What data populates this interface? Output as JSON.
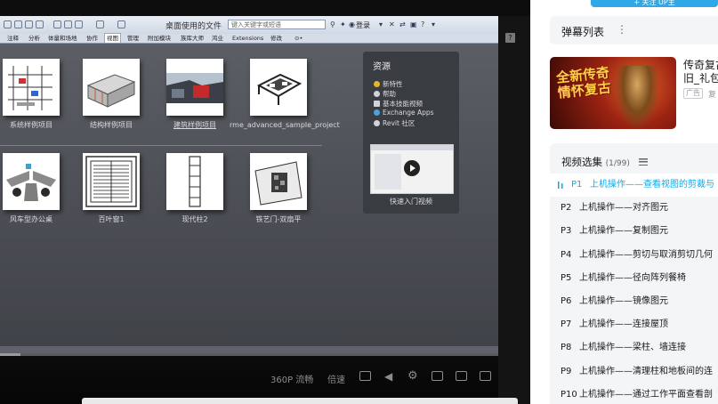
{
  "top_button": {
    "label": "+ 关注 UP主"
  },
  "revit": {
    "doc_title": "桌面使用的文件",
    "search_placeholder": "键入关键字或短语",
    "login_label": "登录",
    "menu": [
      "注释",
      "分析",
      "体量和场地",
      "协作",
      "视图",
      "管理",
      "附加模块",
      "族库大师",
      "鸿业",
      "Extensions",
      "修改",
      "⊙•"
    ],
    "active_menu_index": 4,
    "thumbnails": [
      {
        "label": "系统样例项目",
        "icon": "frame-model-icon"
      },
      {
        "label": "结构样例项目",
        "icon": "structure-model-icon"
      },
      {
        "label": "建筑样例项目",
        "icon": "building-render-icon"
      },
      {
        "label": "rme_advanced_sample_project",
        "icon": "mep-model-icon"
      },
      {
        "label": "风车型办公桌",
        "icon": "desk-icon"
      },
      {
        "label": "百叶窗1",
        "icon": "louver-icon"
      },
      {
        "label": "现代柱2",
        "icon": "column-icon"
      },
      {
        "label": "铁艺门-双扇平",
        "icon": "iron-door-icon"
      }
    ],
    "resources": {
      "title": "资源",
      "items": [
        "新特性",
        "帮助",
        "基本技能视频",
        "Exchange Apps",
        "Revit 社区"
      ],
      "video_label": "快速入门视频"
    }
  },
  "player": {
    "progress_fraction": 0.04,
    "controls": {
      "quality": "360P 流畅",
      "speed": "倍速"
    }
  },
  "danmaku": {
    "title": "弹幕列表"
  },
  "ad": {
    "image_text": "全新传奇 情怀复古",
    "title_line1": "传奇复古",
    "title_line2": "旧_礼包",
    "badge": "广告",
    "extra": "复"
  },
  "playlist": {
    "title": "视频选集",
    "count": "(1/99)",
    "items": [
      {
        "no": "P1",
        "title": "上机操作——查看视图的剪裁与"
      },
      {
        "no": "P2",
        "title": "上机操作——对齐图元"
      },
      {
        "no": "P3",
        "title": "上机操作——复制图元"
      },
      {
        "no": "P4",
        "title": "上机操作——剪切与取消剪切几何"
      },
      {
        "no": "P5",
        "title": "上机操作——径向阵列餐椅"
      },
      {
        "no": "P6",
        "title": "上机操作——镜像图元"
      },
      {
        "no": "P7",
        "title": "上机操作——连接屋顶"
      },
      {
        "no": "P8",
        "title": "上机操作——梁柱、墙连接"
      },
      {
        "no": "P9",
        "title": "上机操作——清理柱和地板间的连"
      },
      {
        "no": "P10",
        "title": "上机操作——通过工作平面查看剖"
      }
    ],
    "active_index": 0
  },
  "colors": {
    "accent": "#00aeec",
    "follow_button": "#2fa8e8",
    "panel_bg": "#f4f5f7"
  }
}
